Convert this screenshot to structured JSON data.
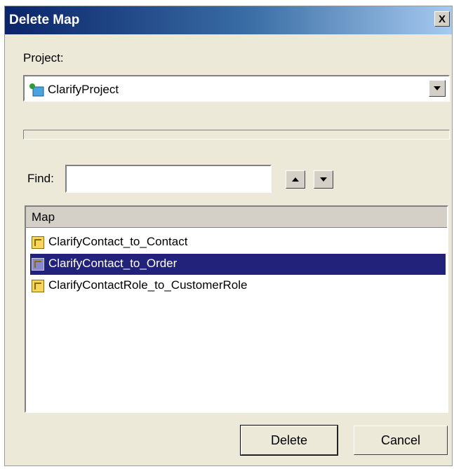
{
  "window": {
    "title": "Delete Map",
    "close_glyph": "X"
  },
  "project": {
    "label": "Project:",
    "selected": "ClarifyProject",
    "icon": "project-icon"
  },
  "find": {
    "label": "Find:",
    "value": ""
  },
  "map_list": {
    "header": "Map",
    "items": [
      {
        "label": "ClarifyContact_to_Contact",
        "selected": false,
        "icon": "map-icon"
      },
      {
        "label": "ClarifyContact_to_Order",
        "selected": true,
        "icon": "map-icon"
      },
      {
        "label": "ClarifyContactRole_to_CustomerRole",
        "selected": false,
        "icon": "map-icon"
      }
    ]
  },
  "buttons": {
    "delete": "Delete",
    "cancel": "Cancel"
  },
  "colors": {
    "title_bar": "#0a246a",
    "selection": "#22227a",
    "dialog_bg": "#ece9d8"
  }
}
